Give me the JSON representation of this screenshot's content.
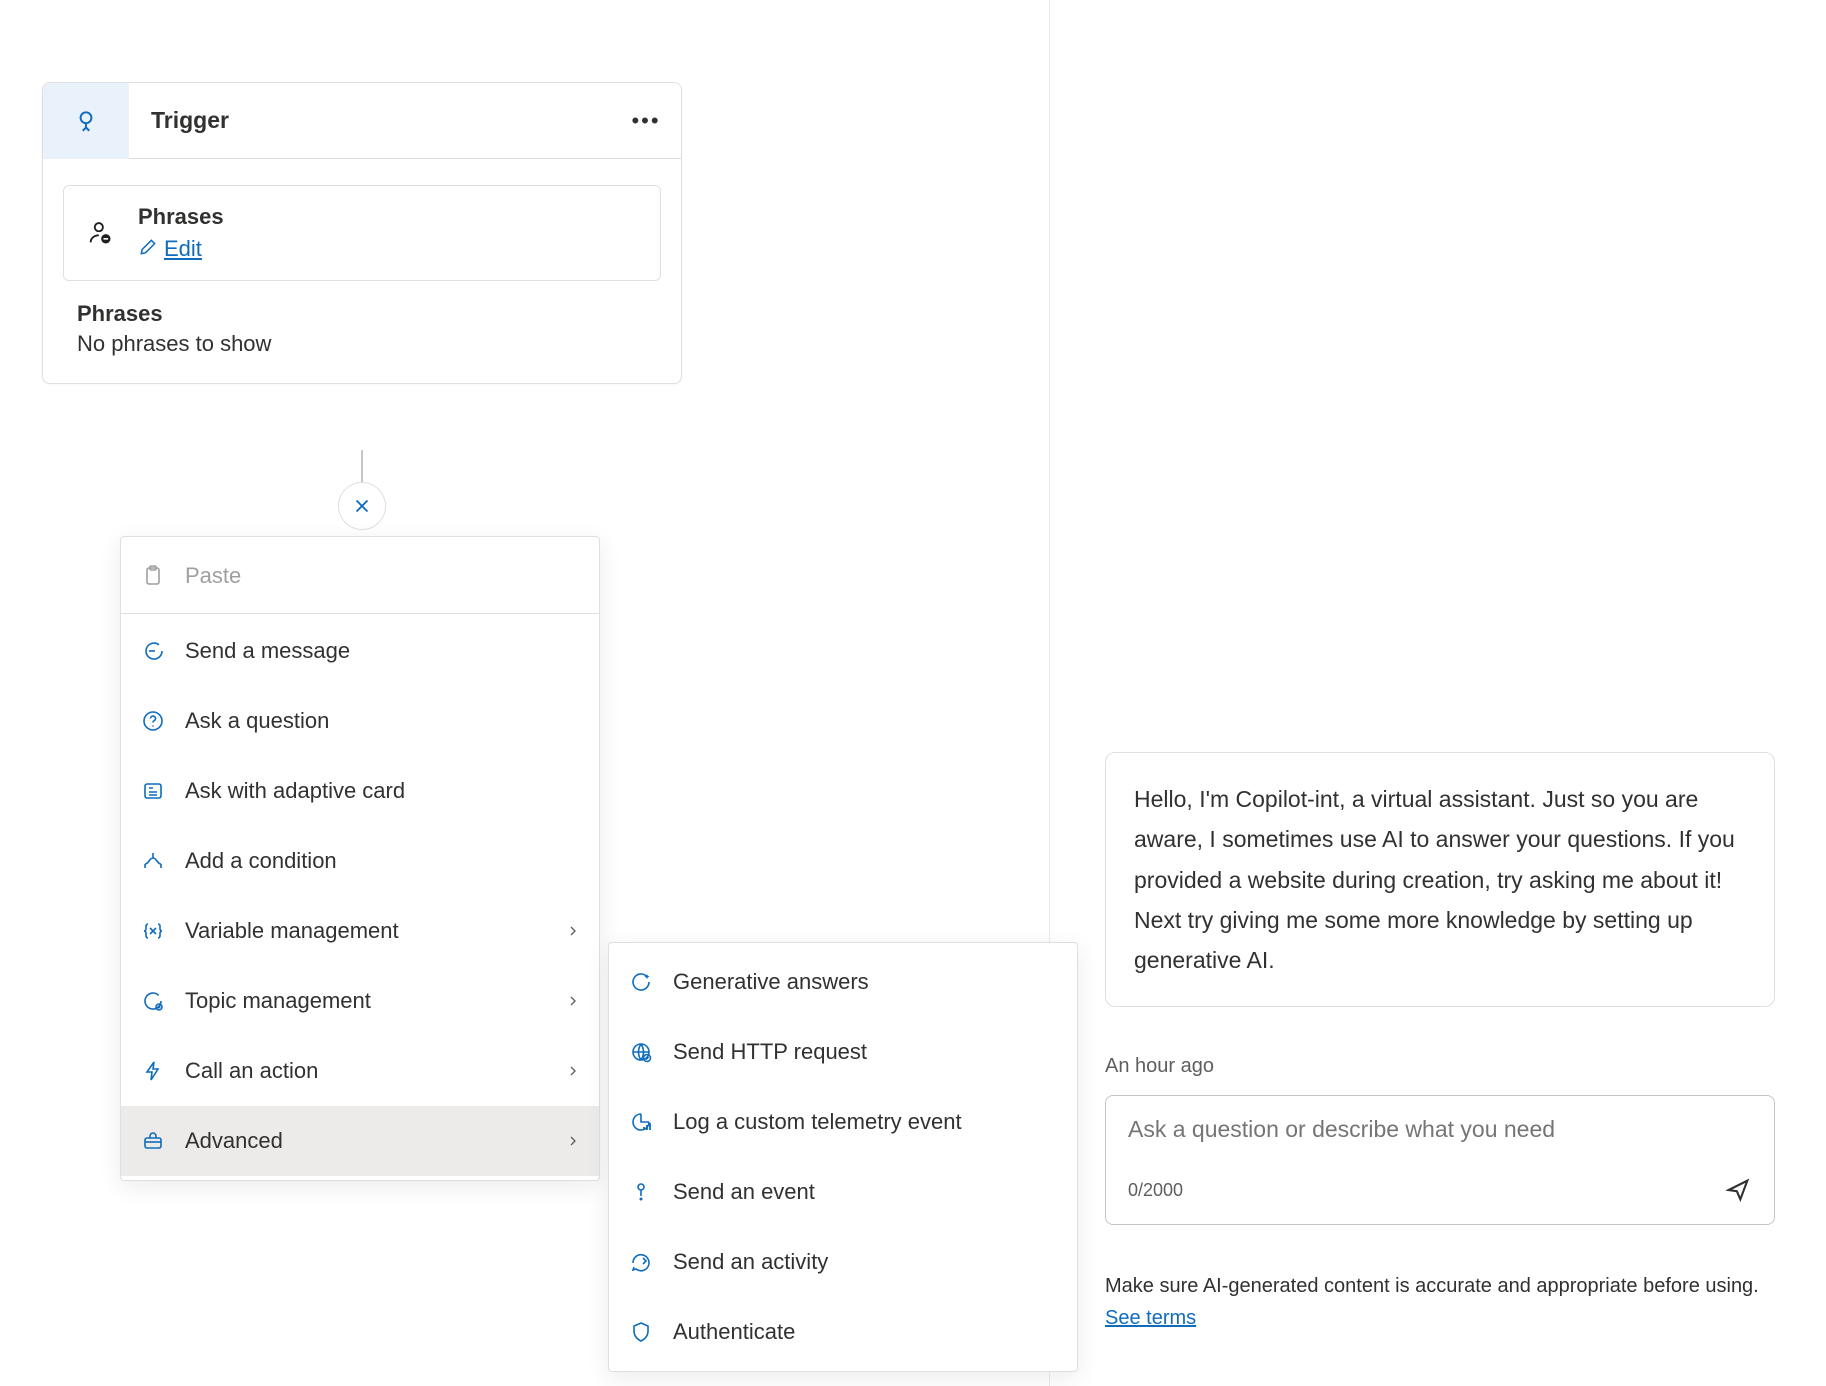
{
  "trigger": {
    "title": "Trigger",
    "phrases_label": "Phrases",
    "edit_label": "Edit",
    "phrases_section_title": "Phrases",
    "phrases_empty": "No phrases to show"
  },
  "menu": {
    "primary": [
      {
        "key": "paste",
        "label": "Paste",
        "disabled": true,
        "submenu": false
      },
      {
        "key": "send-message",
        "label": "Send a message",
        "submenu": false
      },
      {
        "key": "ask-question",
        "label": "Ask a question",
        "submenu": false
      },
      {
        "key": "ask-adaptive",
        "label": "Ask with adaptive card",
        "submenu": false
      },
      {
        "key": "add-condition",
        "label": "Add a condition",
        "submenu": false
      },
      {
        "key": "variable-mgmt",
        "label": "Variable management",
        "submenu": true
      },
      {
        "key": "topic-mgmt",
        "label": "Topic management",
        "submenu": true
      },
      {
        "key": "call-action",
        "label": "Call an action",
        "submenu": true
      },
      {
        "key": "advanced",
        "label": "Advanced",
        "submenu": true,
        "selected": true
      }
    ],
    "advanced": [
      {
        "key": "gen-answers",
        "label": "Generative answers"
      },
      {
        "key": "http",
        "label": "Send HTTP request"
      },
      {
        "key": "telemetry",
        "label": "Log a custom telemetry event"
      },
      {
        "key": "event",
        "label": "Send an event"
      },
      {
        "key": "activity",
        "label": "Send an activity"
      },
      {
        "key": "auth",
        "label": "Authenticate"
      }
    ]
  },
  "chat": {
    "bot_message": "Hello, I'm Copilot-int, a virtual assistant. Just so you are aware, I sometimes use AI to answer your questions. If you provided a website during creation, try asking me about it! Next try giving me some more knowledge by setting up generative AI.",
    "timestamp": "An hour ago",
    "input_placeholder": "Ask a question or describe what you need",
    "char_count": "0/2000",
    "disclaimer": "Make sure AI-generated content is accurate and appropriate before using. ",
    "terms_label": "See terms"
  }
}
